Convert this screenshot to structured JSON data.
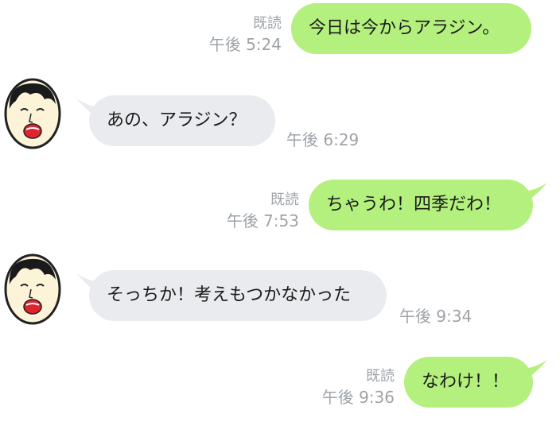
{
  "colors": {
    "sent_bubble": "#b4f07e",
    "received_bubble": "#e9ebee",
    "meta_text": "#9ea3a8"
  },
  "messages": [
    {
      "direction": "sent",
      "text": "今日は今からアラジン。",
      "read": "既読",
      "time": "午後 5:24"
    },
    {
      "direction": "received",
      "text": "あの、アラジン？",
      "time": "午後 6:29",
      "avatar_icon": "cartoon-face-avatar-icon"
    },
    {
      "direction": "sent",
      "text": "ちゃうわ！四季だわ！",
      "read": "既読",
      "time": "午後 7:53"
    },
    {
      "direction": "received",
      "text": "そっちか！考えもつかなかった",
      "time": "午後 9:34",
      "avatar_icon": "cartoon-face-avatar-icon"
    },
    {
      "direction": "sent",
      "text": "なわけ！！",
      "read": "既読",
      "time": "午後 9:36"
    }
  ]
}
